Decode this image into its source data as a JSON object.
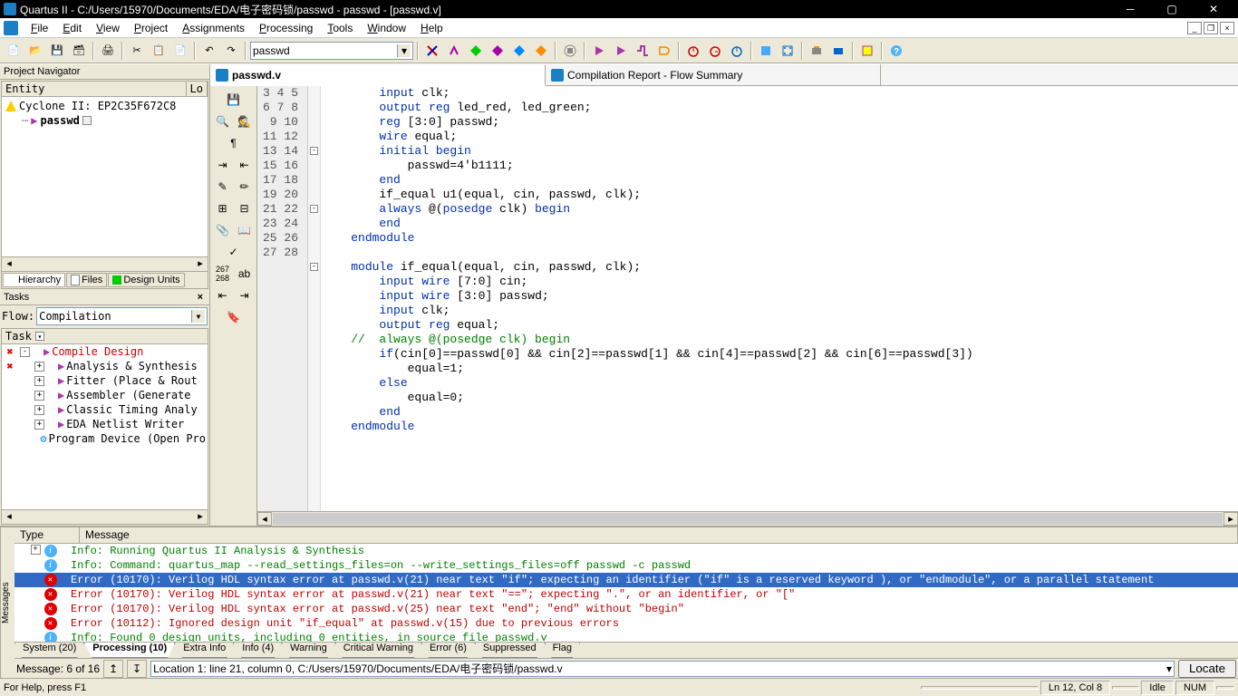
{
  "title": "Quartus II - C:/Users/15970/Documents/EDA/电子密码锁/passwd - passwd - [passwd.v]",
  "menus": [
    "File",
    "Edit",
    "View",
    "Project",
    "Assignments",
    "Processing",
    "Tools",
    "Window",
    "Help"
  ],
  "combo_main": "passwd",
  "navigator": {
    "title": "Project Navigator",
    "col_entity": "Entity",
    "col_lo": "Lo",
    "device": "Cyclone II: EP2C35F672C8",
    "entity1": "passwd",
    "tabs": [
      "Hierarchy",
      "Files",
      "Design Units"
    ]
  },
  "tasks_panel": {
    "title": "Tasks",
    "flow_label": "Flow:",
    "flow_value": "Compilation",
    "task_header": "Task",
    "items": [
      {
        "x": true,
        "exp": "-",
        "label": "Compile Design",
        "color": "#c00"
      },
      {
        "x": true,
        "exp": "+",
        "indent": 1,
        "label": "Analysis & Synthesis"
      },
      {
        "x": false,
        "exp": "+",
        "indent": 1,
        "label": "Fitter (Place & Rout"
      },
      {
        "x": false,
        "exp": "+",
        "indent": 1,
        "label": "Assembler (Generate"
      },
      {
        "x": false,
        "exp": "+",
        "indent": 1,
        "label": "Classic Timing Analy"
      },
      {
        "x": false,
        "exp": "+",
        "indent": 1,
        "label": "EDA Netlist Writer"
      },
      {
        "x": false,
        "exp": "",
        "indent": 1,
        "label": "Program Device (Open Pro",
        "prog": true
      }
    ]
  },
  "editor_tabs": [
    {
      "label": "passwd.v",
      "active": true
    },
    {
      "label": "Compilation Report - Flow Summary",
      "active": false
    }
  ],
  "gutter_start": 3,
  "gutter_end": 28,
  "code_lines": [
    "        <span class='kw'>input</span> clk;",
    "        <span class='kw'>output</span> <span class='kw'>reg</span> led_red, led_green;",
    "        <span class='kw'>reg</span> [3:0] passwd;",
    "        <span class='kw'>wire</span> equal;",
    "        <span class='kw'>initial begin</span>",
    "            passwd=4'b1111;",
    "        <span class='kw'>end</span>",
    "        if_equal u1(equal, cin, passwd, clk);",
    "        <span class='kw'>always</span> @(<span class='kw'>posedge</span> clk) <span class='kw'>begin</span>",
    "        <span class='kw'>end</span>",
    "    <span class='kw'>endmodule</span>",
    "",
    "    <span class='kw'>module</span> if_equal(equal, cin, passwd, clk);",
    "        <span class='kw'>input</span> <span class='kw'>wire</span> [7:0] cin;",
    "        <span class='kw'>input</span> <span class='kw'>wire</span> [3:0] passwd;",
    "        <span class='kw'>input</span> clk;",
    "        <span class='kw'>output</span> <span class='kw'>reg</span> equal;",
    "<span class='cm'>    //  always @(posedge clk) begin</span>",
    "        <span class='kw'>if</span>(cin[0]==passwd[0] && cin[2]==passwd[1] && cin[4]==passwd[2] && cin[6]==passwd[3])",
    "            equal=1;",
    "        <span class='kw'>else</span>",
    "            equal=0;",
    "        <span class='kw'>end</span>",
    "    <span class='kw'>endmodule</span>",
    "",
    ""
  ],
  "messages": {
    "col_type": "Type",
    "col_msg": "Message",
    "rows": [
      {
        "kind": "info",
        "exp": true,
        "text": "Info: Running Quartus II Analysis & Synthesis"
      },
      {
        "kind": "info",
        "text": "Info: Command: quartus_map --read_settings_files=on --write_settings_files=off passwd -c passwd"
      },
      {
        "kind": "error",
        "sel": true,
        "text": "Error (10170): Verilog HDL syntax error at passwd.v(21) near text \"if\";  expecting an identifier (\"if\" is a reserved keyword ), or \"endmodule\", or a parallel statement"
      },
      {
        "kind": "error",
        "text": "Error (10170): Verilog HDL syntax error at passwd.v(21) near text \"==\";  expecting \".\", or an identifier, or \"[\""
      },
      {
        "kind": "error",
        "text": "Error (10170): Verilog HDL syntax error at passwd.v(25) near text \"end\"; \"end\" without \"begin\""
      },
      {
        "kind": "error",
        "text": "Error (10112): Ignored design unit \"if_equal\" at passwd.v(15) due to previous errors"
      },
      {
        "kind": "info",
        "text": "Info: Found 0 design units, including 0 entities, in source file passwd.v"
      }
    ],
    "tabs": [
      "System (20)",
      "Processing (10)",
      "Extra Info",
      "Info (4)",
      "Warning",
      "Critical Warning",
      "Error (6)",
      "Suppressed",
      "Flag"
    ],
    "active_tab": 1,
    "status_count": "Message: 6 of 16",
    "location": "Location 1: line 21, column 0, C:/Users/15970/Documents/EDA/电子密码锁/passwd.v",
    "locate_btn": "Locate"
  },
  "statusbar": {
    "help": "For Help, press F1",
    "lncol": "Ln 12, Col 8",
    "idle": "Idle",
    "num": "NUM"
  }
}
